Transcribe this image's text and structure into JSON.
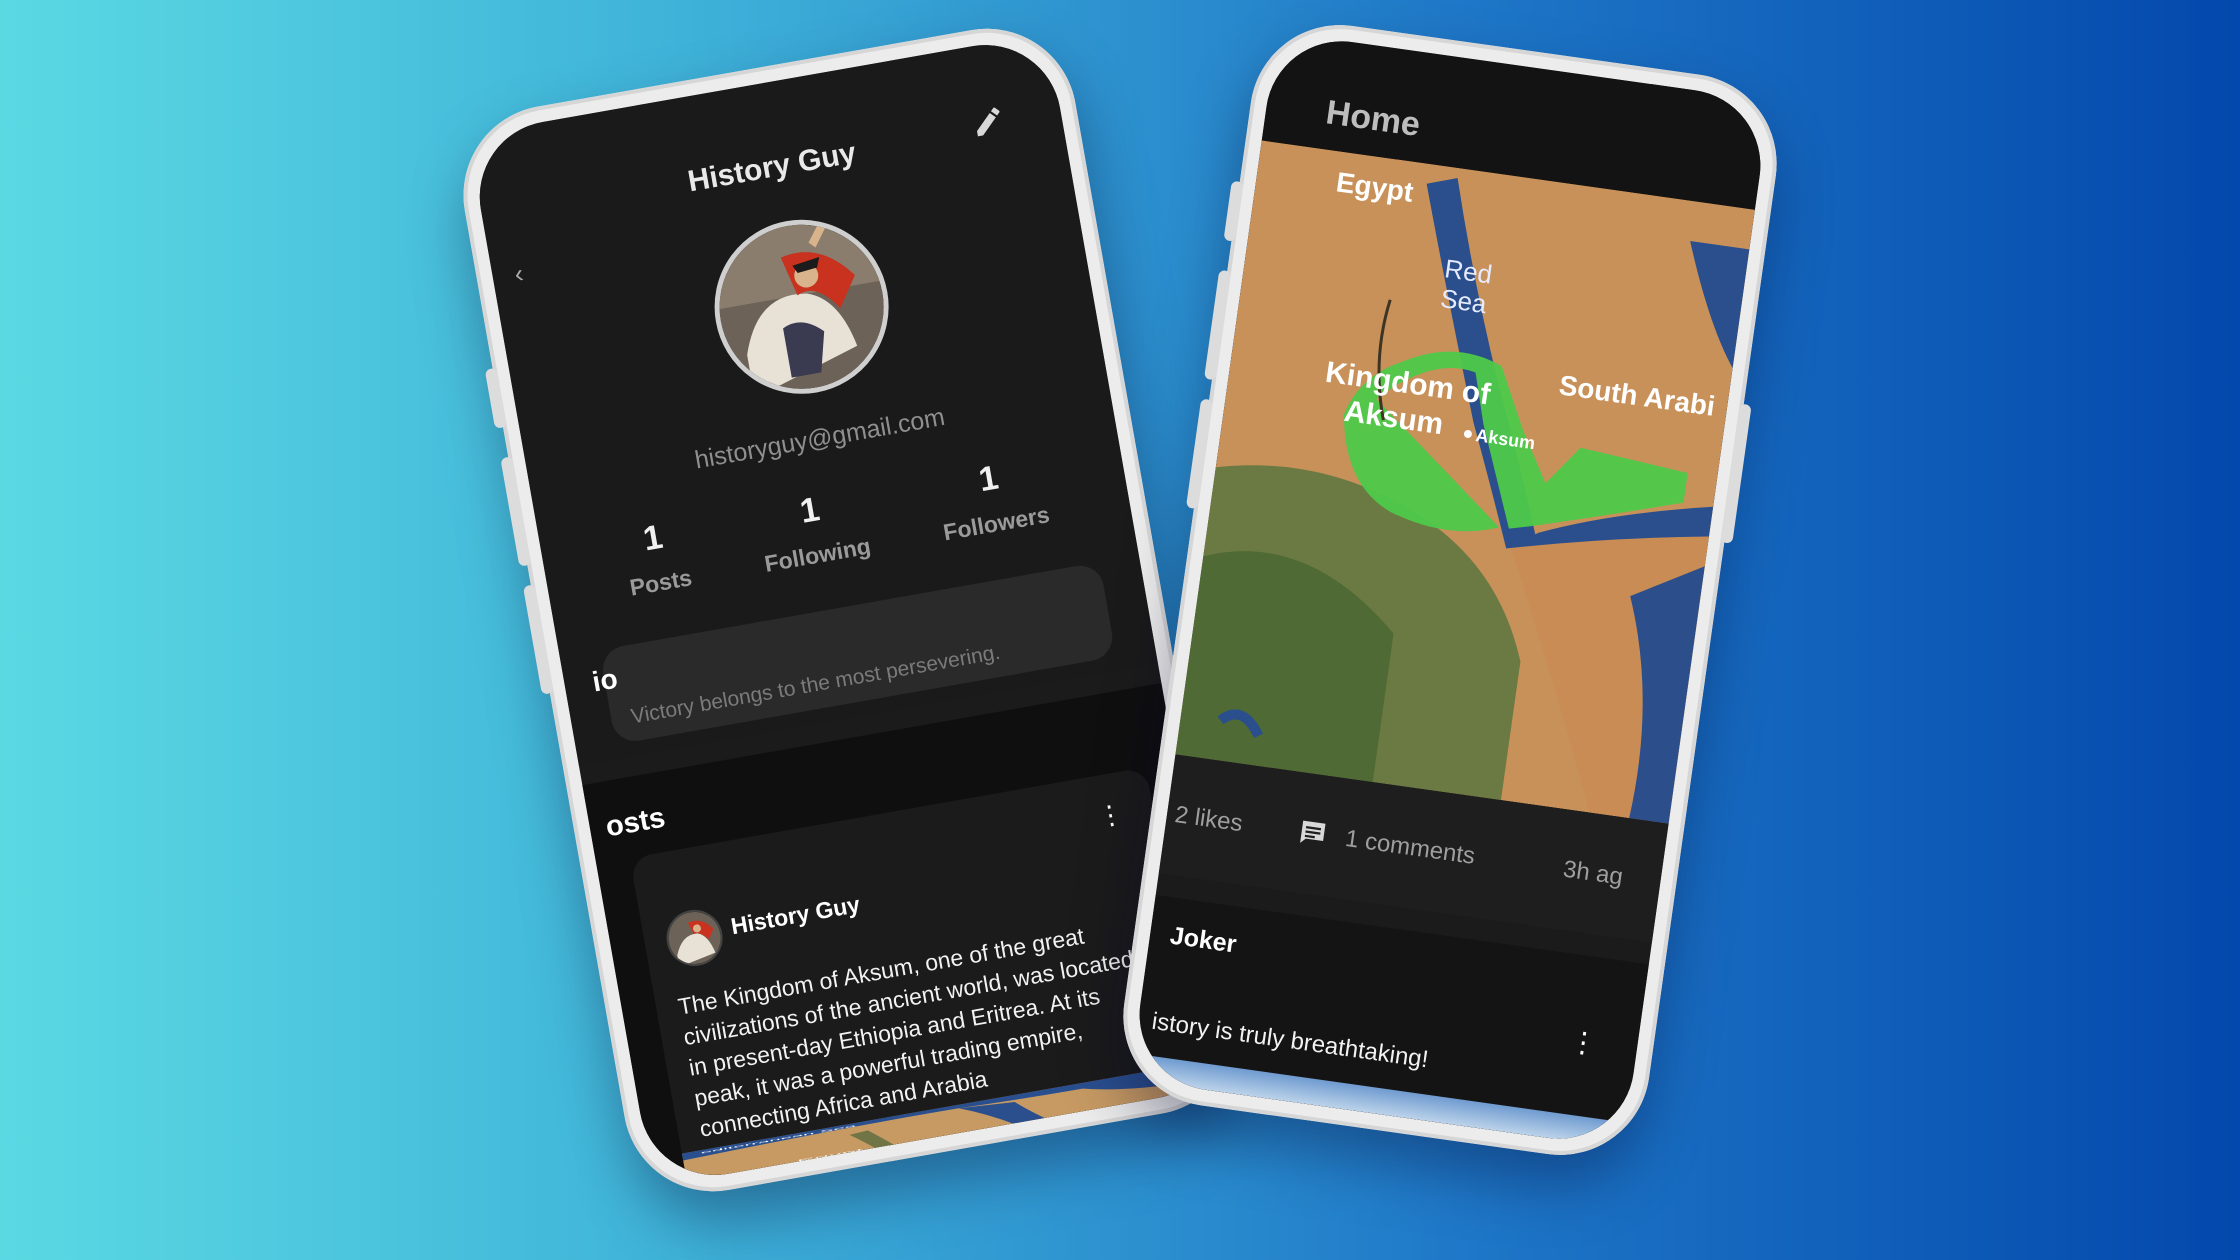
{
  "profile_screen": {
    "title": "History Guy",
    "email": "historyguy@gmail.com",
    "stats": [
      {
        "value": "1",
        "label": "Posts"
      },
      {
        "value": "1",
        "label": "Following"
      },
      {
        "value": "1",
        "label": "Followers"
      }
    ],
    "bio_heading": "io",
    "bio_text": "Victory belongs to the most persevering.",
    "posts_heading": "osts",
    "post": {
      "author": "History Guy",
      "text": "The Kingdom of Aksum, one of the great civilizations of the ancient world, was located in present-day Ethiopia and Eritrea. At its peak, it was a powerful trading empire, connecting Africa and Arabia",
      "map_labels": {
        "sea": "editerranean Sea",
        "egypt": "Egypt"
      }
    },
    "icons": {
      "edit": "pencil-icon",
      "menu": "more-vert-icon"
    }
  },
  "home_screen": {
    "title": "Home",
    "map_labels": {
      "egypt": "Egypt",
      "red": "Red",
      "sea": "Sea",
      "kingdom1": "Kingdom of",
      "kingdom2": "Aksum",
      "city": "Aksum",
      "south_arabia": "South Arabi"
    },
    "likes": "2 likes",
    "comments": "1 comments",
    "time": "3h ag",
    "next_post": {
      "author": "Joker",
      "text": "istory is truly breathtaking!"
    },
    "icons": {
      "comment": "comment-icon",
      "menu": "more-vert-icon"
    }
  }
}
